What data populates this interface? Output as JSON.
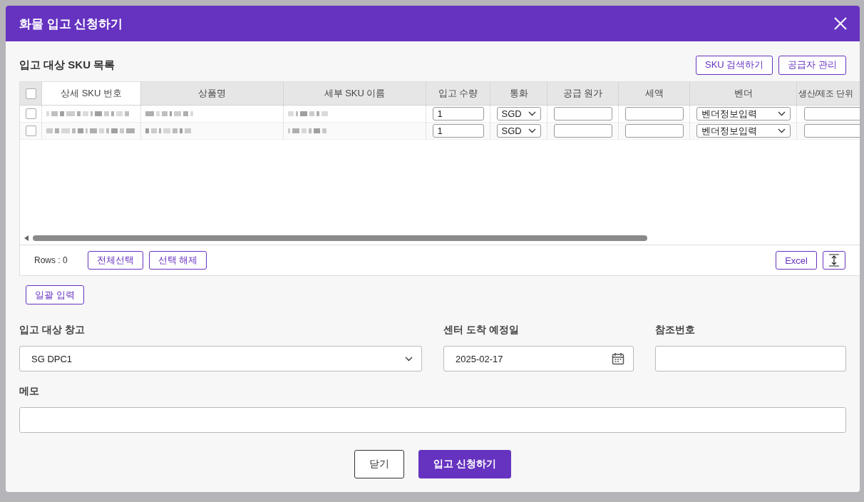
{
  "dialog": {
    "title": "화물 입고 신청하기"
  },
  "sku_section": {
    "title": "입고 대상 SKU 목록",
    "buttons": [
      "SKU 검색하기",
      "공급자 관리"
    ]
  },
  "table": {
    "columns": [
      {
        "label": "상세 SKU 번호",
        "selected": true
      },
      {
        "label": "상품명",
        "selected": false
      },
      {
        "label": "세부 SKU 이름",
        "selected": false
      },
      {
        "label": "입고 수량",
        "selected": false
      },
      {
        "label": "통화",
        "selected": false
      },
      {
        "label": "공급 원가",
        "selected": false
      },
      {
        "label": "세액",
        "selected": false
      },
      {
        "label": "벤더",
        "selected": false
      },
      {
        "label": "생산/제조 단위",
        "selected": false
      }
    ],
    "rows": [
      {
        "checked": false,
        "quantity": "1",
        "currency": "SGD",
        "vendor": "벤더정보입력"
      },
      {
        "checked": false,
        "quantity": "1",
        "currency": "SGD",
        "vendor": "벤더정보입력"
      }
    ],
    "rows_count": "Rows : 0",
    "all_checked": false,
    "footer_buttons": [
      "전체선택",
      "선택 해제"
    ],
    "excel_button": "Excel"
  },
  "bulk_button": "일괄 입력",
  "form": {
    "warehouse": {
      "label": "입고 대상 창고",
      "value": "SG DPC1"
    },
    "arrival_date": {
      "label": "센터 도착 예정일",
      "value": "2025-02-17"
    },
    "reference": {
      "label": "참조번호"
    },
    "memo": {
      "label": "메모"
    }
  },
  "actions": [
    {
      "label": "닫기",
      "kind": "secondary"
    },
    {
      "label": "입고 신청하기",
      "kind": "primary"
    }
  ]
}
